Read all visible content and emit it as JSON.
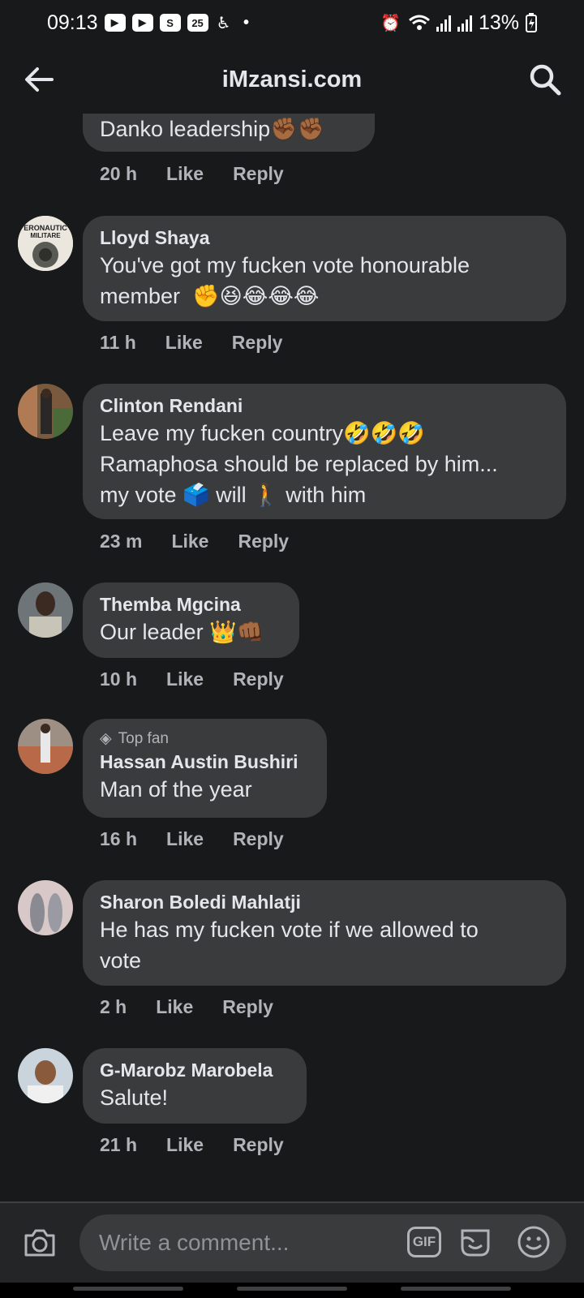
{
  "status": {
    "time": "09:13",
    "battery": "13%",
    "notification_icons": [
      "youtube-icon",
      "youtube-icon",
      "s-icon",
      "calendar-icon",
      "accessibility-icon"
    ],
    "calendar_day": "25",
    "s_letter": "S"
  },
  "header": {
    "title": "iMzansi.com"
  },
  "comments": [
    {
      "author": "",
      "text": "Danko leadership✊🏾✊🏾",
      "time": "20 h",
      "like": "Like",
      "reply": "Reply"
    },
    {
      "author": "Lloyd Shaya",
      "avatar_text": "ERONAUTIC\nMILITARE",
      "text": "You've got my fucken vote honourable\nmember  ✊😆😂😂😂",
      "time": "11 h",
      "like": "Like",
      "reply": "Reply"
    },
    {
      "author": "Clinton Rendani",
      "text": "Leave my fucken country🤣🤣🤣\nRamaphosa should be replaced by him...\nmy vote 🗳️ will 🚶 with him",
      "time": "23 m",
      "like": "Like",
      "reply": "Reply"
    },
    {
      "author": "Themba Mgcina",
      "text": "Our leader 👑👊🏾",
      "time": "10 h",
      "like": "Like",
      "reply": "Reply"
    },
    {
      "badge": "Top fan",
      "author": "Hassan Austin Bushiri",
      "text": "Man of the year",
      "time": "16 h",
      "like": "Like",
      "reply": "Reply"
    },
    {
      "author": "Sharon Boledi Mahlatji",
      "text": "He has my fucken vote if we allowed to\nvote",
      "time": "2 h",
      "like": "Like",
      "reply": "Reply"
    },
    {
      "author": "G-Marobz Marobela",
      "text": "Salute!",
      "time": "21 h",
      "like": "Like",
      "reply": "Reply"
    }
  ],
  "composer": {
    "placeholder": "Write a comment...",
    "gif_label": "GIF"
  },
  "colors": {
    "background": "#18191a",
    "bubble": "#3a3b3c",
    "text": "#e4e6eb",
    "secondary": "#b0b3b8"
  }
}
